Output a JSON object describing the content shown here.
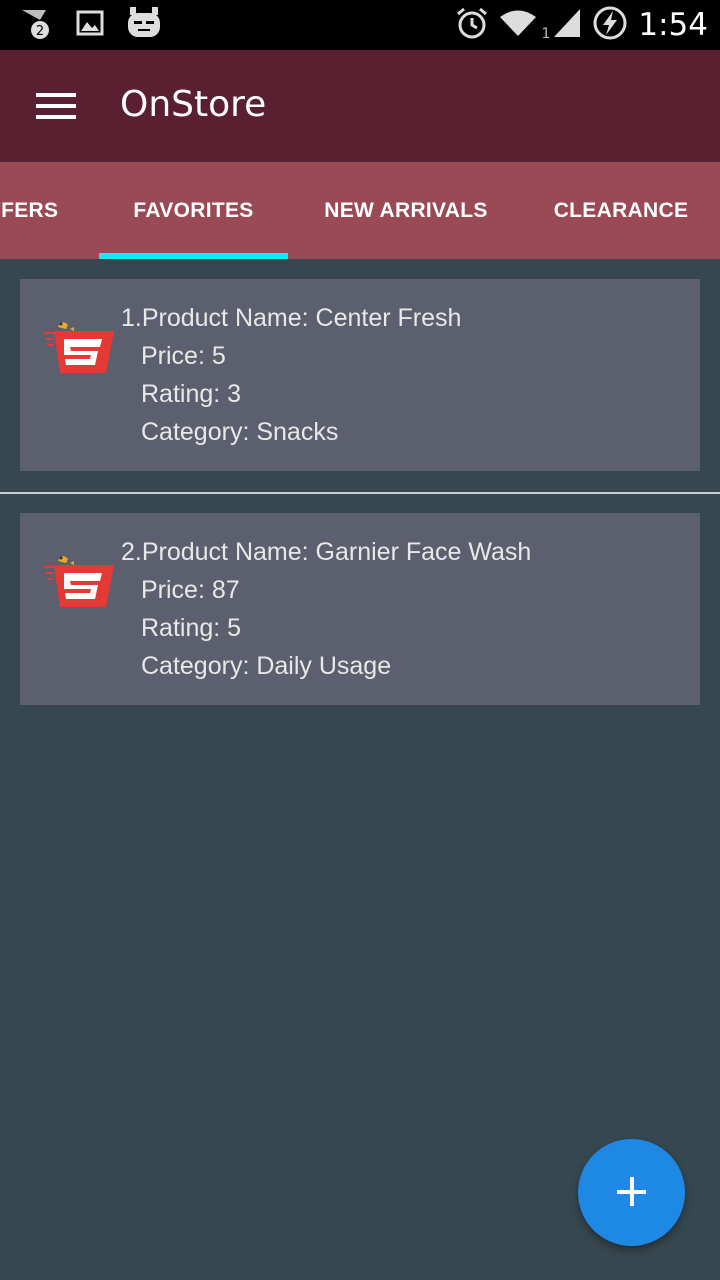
{
  "status_bar": {
    "notification_count": "2",
    "signal_sim": "1",
    "time": "1:54",
    "icons": [
      "notification-icon",
      "image-icon",
      "cyanogen-icon",
      "alarm-icon",
      "wifi-icon",
      "signal-icon",
      "battery-charging-icon"
    ]
  },
  "app_bar": {
    "title": "OnStore",
    "menu_icon": "menu-icon"
  },
  "tabs": [
    {
      "label": "FFERS"
    },
    {
      "label": "FAVORITES",
      "selected": true
    },
    {
      "label": "NEW ARRIVALS"
    },
    {
      "label": "CLEARANCE"
    }
  ],
  "products": [
    {
      "name_line": "1.Product Name: Center Fresh",
      "price_line": "Price: 5",
      "rating_line": "Rating: 3",
      "category_line": "Category: Snacks"
    },
    {
      "name_line": "2.Product Name: Garnier Face Wash",
      "price_line": "Price: 87",
      "rating_line": "Rating: 5",
      "category_line": "Category: Daily Usage"
    }
  ],
  "fab": {
    "icon": "plus-icon"
  },
  "colors": {
    "app_bar": "#5A2031",
    "tab_bar": "#9A4A54",
    "tab_indicator": "#18E8F0",
    "background": "#37474F",
    "card": "#5C606E",
    "fab": "#1E88E5"
  }
}
